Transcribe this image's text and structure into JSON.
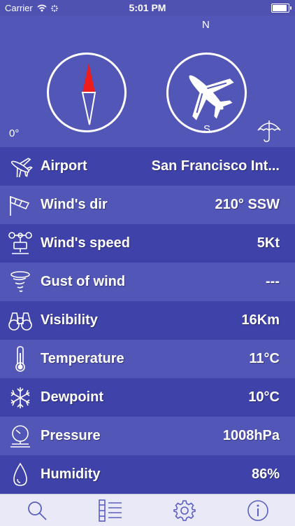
{
  "status_bar": {
    "carrier": "Carrier",
    "time": "5:01 PM"
  },
  "header": {
    "north": "N",
    "south": "S",
    "heading": "0°",
    "icons": {
      "compass": "compass-needle-icon",
      "airplane": "airplane-icon",
      "umbrella": "umbrella-icon"
    }
  },
  "rows": [
    {
      "label": "Airport",
      "value": "San Francisco Int...",
      "icon": "airplane-icon"
    },
    {
      "label": "Wind's dir",
      "value": "210° SSW",
      "icon": "windsock-icon"
    },
    {
      "label": "Wind's speed",
      "value": "5Kt",
      "icon": "anemometer-icon"
    },
    {
      "label": "Gust of wind",
      "value": "---",
      "icon": "tornado-icon"
    },
    {
      "label": "Visibility",
      "value": "16Km",
      "icon": "binoculars-icon"
    },
    {
      "label": "Temperature",
      "value": "11°C",
      "icon": "thermometer-icon"
    },
    {
      "label": "Dewpoint",
      "value": "10°C",
      "icon": "snowflake-icon"
    },
    {
      "label": "Pressure",
      "value": "1008hPa",
      "icon": "barometer-icon"
    },
    {
      "label": "Humidity",
      "value": "86%",
      "icon": "droplet-icon"
    }
  ],
  "tab_bar": {
    "tabs": [
      "search-icon",
      "list-icon",
      "gear-icon",
      "info-icon"
    ]
  },
  "colors": {
    "background": "#4f52b0",
    "row_dark": "#3f42a9",
    "row_light": "#5256b6",
    "needle_red": "#ee1c1c",
    "tabbar": "#e9e9f7",
    "tab_icon": "#5a5fc0"
  }
}
